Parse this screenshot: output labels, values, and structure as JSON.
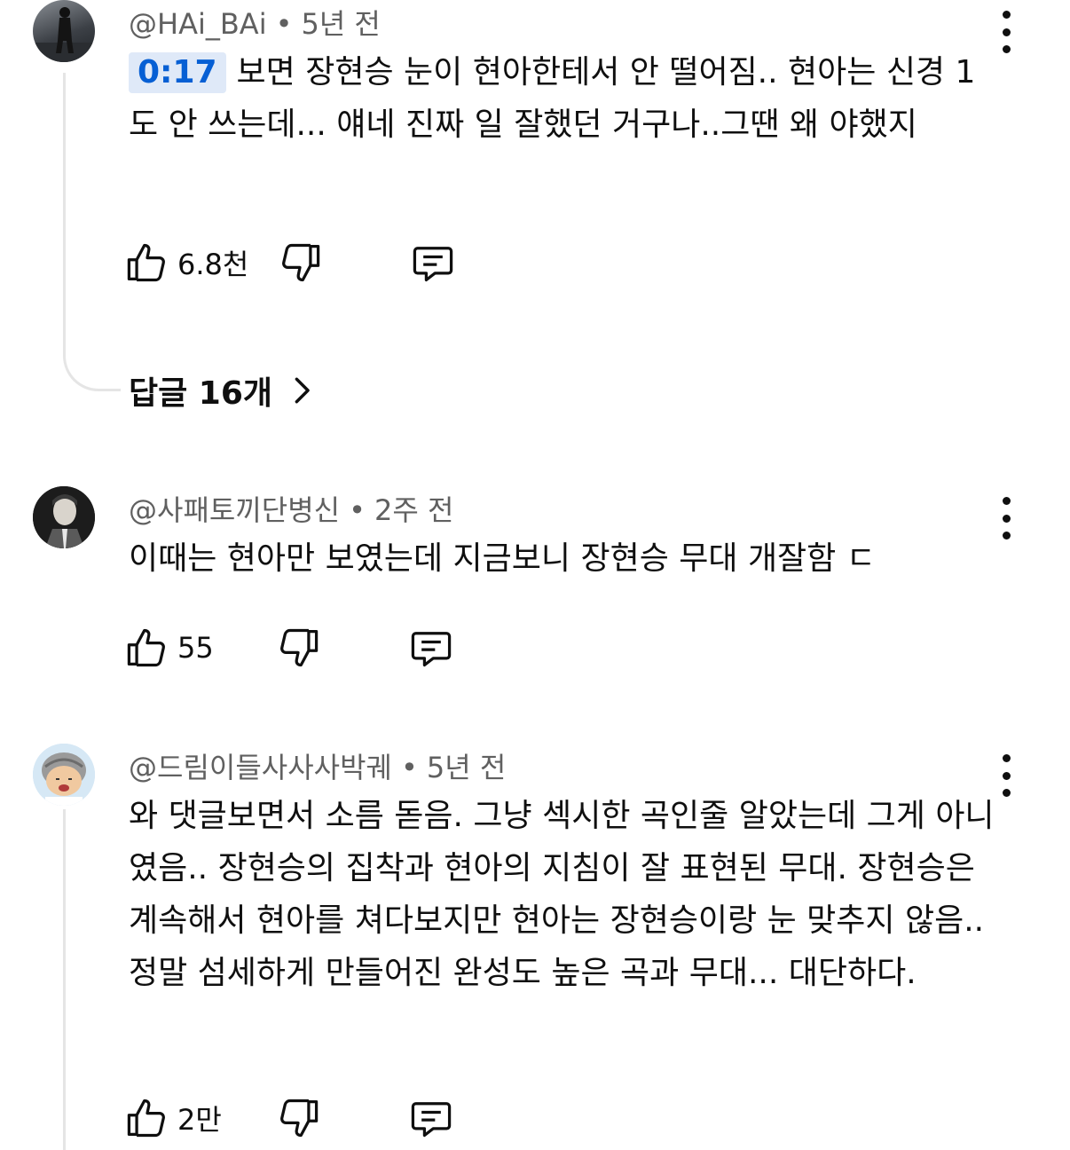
{
  "comments": [
    {
      "handle": "@HAi_BAi",
      "time": "5년 전",
      "timestamp_link": "0:17",
      "text": "보면 장현승 눈이 현아한테서 안 떨어짐.. 현아는 신경 1도 안 쓰는데... 얘네 진짜 일 잘했던 거구나..그땐 왜 야했지",
      "likes": "6.8천",
      "replies_label": "답글 16개"
    },
    {
      "handle": "@사패토끼단병신",
      "time": "2주 전",
      "text": "이때는 현아만 보였는데 지금보니 장현승 무대 개잘함 ㄷ",
      "likes": "55"
    },
    {
      "handle": "@드림이들사사사박궤",
      "time": "5년 전",
      "text": "와 댓글보면서 소름 돋음. 그냥 섹시한 곡인줄 알았는데 그게 아니였음.. 장현승의 집착과 현아의 지침이 잘 표현된 무대. 장현승은 계속해서 현아를 쳐다보지만 현아는 장현승이랑 눈 맞추지 않음.. 정말 섬세하게 만들어진 완성도 높은 곡과 무대... 대단하다.",
      "likes": "2만"
    }
  ],
  "meta_separator": "•",
  "icons": {
    "like": "thumb-up-icon",
    "dislike": "thumb-down-icon",
    "reply": "comment-icon",
    "more": "more-vert-icon",
    "chevron": "chevron-right-icon"
  },
  "colors": {
    "text": "#0f0f0f",
    "meta": "#606060",
    "timestamp_bg": "#dfe9f8",
    "timestamp_fg": "#065fd4",
    "thread_line": "#e5e5e5"
  }
}
